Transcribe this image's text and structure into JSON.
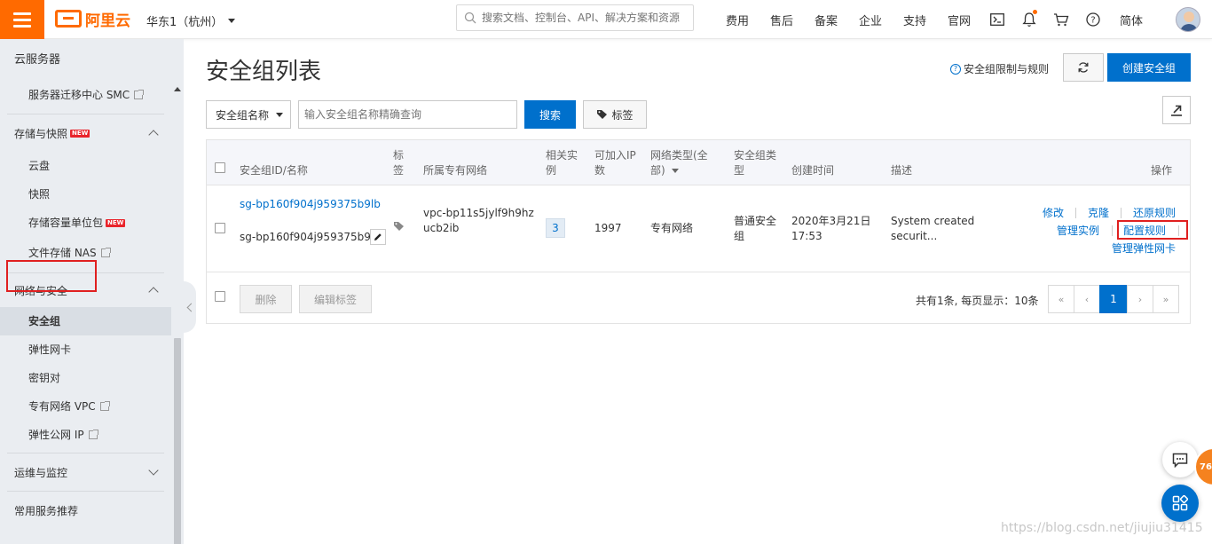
{
  "brand": {
    "logo_text": "阿里云",
    "accent_color": "#ff6a00",
    "primary_color": "#0070cc",
    "highlight_color": "#e02020"
  },
  "topbar": {
    "region": "华东1（杭州）",
    "search_placeholder": "搜索文档、控制台、API、解决方案和资源",
    "links": [
      "费用",
      "售后",
      "备案",
      "企业",
      "支持",
      "官网"
    ],
    "icons": [
      "terminal-icon",
      "bell-icon",
      "cart-icon",
      "help-icon"
    ],
    "language": "简体"
  },
  "sidebar": {
    "title": "云服务器",
    "migration_item": "服务器迁移中心 SMC",
    "storage": {
      "group": "存储与快照",
      "badge": "NEW",
      "items": [
        "云盘",
        "快照",
        "存储容量单位包",
        "文件存储 NAS"
      ],
      "unit_badge": "NEW"
    },
    "network": {
      "group": "网络与安全",
      "items": [
        "安全组",
        "弹性网卡",
        "密钥对",
        "专有网络 VPC",
        "弹性公网 IP"
      ]
    },
    "ops_group": "运维与监控",
    "recommend": "常用服务推荐"
  },
  "main": {
    "title": "安全组列表",
    "limit_link": "安全组限制与规则",
    "create_button": "创建安全组",
    "filter_select": "安全组名称",
    "query_placeholder": "输入安全组名称精确查询",
    "search_button": "搜索",
    "tags_button": "标签"
  },
  "table": {
    "headers": {
      "id_name": "安全组ID/名称",
      "tag": "标签",
      "vpc": "所属专有网络",
      "instances": "相关实例",
      "ips": "可加入IP数",
      "net_type": "网络类型(全部)",
      "sg_type": "安全组类型",
      "created": "创建时间",
      "desc": "描述",
      "ops": "操作"
    },
    "row": {
      "id": "sg-bp160f904j959375b9lb",
      "name": "sg-bp160f904j959375b9l...",
      "vpc": "vpc-bp11s5jylf9h9hzucb2ib",
      "instances": "3",
      "ips": "1997",
      "net_type": "专有网络",
      "sg_type": "普通安全组",
      "created_date": "2020年3月21日",
      "created_time": "17:53",
      "desc": "System created securit...",
      "ops": {
        "modify": "修改",
        "clone": "克隆",
        "restore": "还原规则",
        "manage_instances": "管理实例",
        "config_rules": "配置规则",
        "manage_eni": "管理弹性网卡"
      }
    },
    "footer": {
      "delete_button": "删除",
      "edit_tags_button": "编辑标签",
      "summary": "共有1条, 每页显示：10条",
      "pages": [
        "«",
        "‹",
        "1",
        "›",
        "»"
      ]
    }
  },
  "floating": {
    "badge_count": "76"
  },
  "watermark": "https://blog.csdn.net/jiujiu31415"
}
